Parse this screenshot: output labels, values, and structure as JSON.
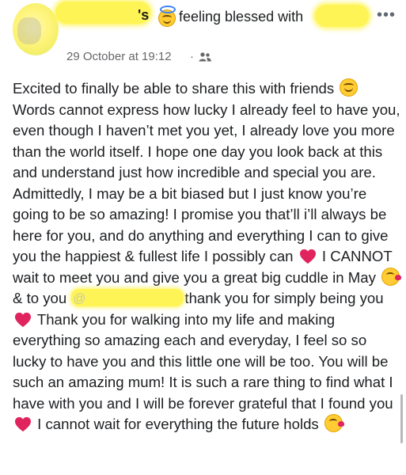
{
  "header": {
    "name_tail": "'s",
    "activity": "feeling blessed with",
    "more_label": "•••",
    "timestamp": "29 October at 19:12",
    "separator": "·"
  },
  "icons": {
    "halo": "smiling-face-with-halo-icon",
    "audience": "friends-audience-icon",
    "smile": "smiling-face-icon",
    "heart": "red-heart-icon",
    "kiss": "face-blowing-kiss-icon"
  },
  "colors": {
    "text": "#1c1e21",
    "meta": "#65676b",
    "redaction": "#fff456",
    "heart": "#e0245e"
  },
  "post": {
    "p1": "Excited to finally be able to share this with friends",
    "p2": "Words cannot express how lucky I already feel to have you, even though I haven’t met you yet, I already love you more than the world itself. I hope one day you look back at this and understand just how incredible and special you are. Admittedly, I may be a bit biased but I just know you’re going to be so amazing! I promise you that’ll i’ll always be here for you, and do anything and everything I can to give you the happiest & fullest life I possibly can",
    "p3": "I CANNOT wait to meet you and give you a great big cuddle in May",
    "p4": "& to you",
    "mention_at": "@",
    "p5": "thank you for simply being you",
    "p6": "Thank you for walking into my life and making everything so amazing each and everyday, I feel so so lucky to have you and this little one will be too. You will be such an amazing mum! It is such a rare thing to find what I have with you and I will be forever grateful that I found you",
    "p7": "I cannot wait for everything the future holds"
  }
}
